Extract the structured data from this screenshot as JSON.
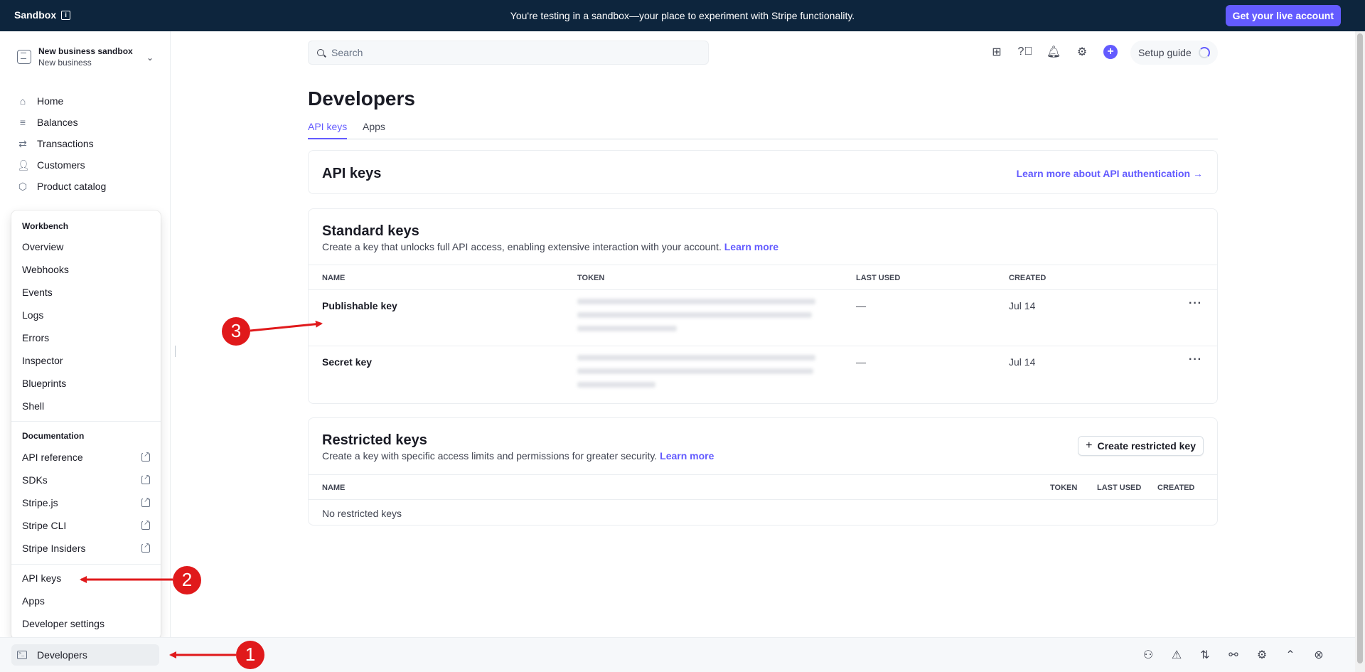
{
  "banner": {
    "sandbox_label": "Sandbox",
    "message": "You're testing in a sandbox—your place to experiment with Stripe functionality.",
    "live_button": "Get your live account"
  },
  "account": {
    "name": "New business sandbox",
    "sub": "New business"
  },
  "nav": [
    {
      "label": "Home",
      "icon": "home-icon"
    },
    {
      "label": "Balances",
      "icon": "balances-icon"
    },
    {
      "label": "Transactions",
      "icon": "transactions-icon"
    },
    {
      "label": "Customers",
      "icon": "customers-icon"
    },
    {
      "label": "Product catalog",
      "icon": "product-catalog-icon"
    }
  ],
  "popup": {
    "workbench_heading": "Workbench",
    "workbench_items": [
      "Overview",
      "Webhooks",
      "Events",
      "Logs",
      "Errors",
      "Inspector",
      "Blueprints",
      "Shell"
    ],
    "documentation_heading": "Documentation",
    "doc_items": [
      "API reference",
      "SDKs",
      "Stripe.js",
      "Stripe CLI",
      "Stripe Insiders"
    ],
    "dev_items": [
      "API keys",
      "Apps",
      "Developer settings"
    ]
  },
  "bottom": {
    "developers_label": "Developers"
  },
  "search": {
    "placeholder": "Search"
  },
  "header": {
    "setup_guide": "Setup guide"
  },
  "page": {
    "title": "Developers",
    "tabs": [
      "API keys",
      "Apps"
    ]
  },
  "api_keys_card": {
    "title": "API keys",
    "link": "Learn more about API authentication →"
  },
  "standard_keys": {
    "title": "Standard keys",
    "description": "Create a key that unlocks full API access, enabling extensive interaction with your account.",
    "learn_more": "Learn more",
    "columns": [
      "NAME",
      "TOKEN",
      "LAST USED",
      "CREATED"
    ],
    "rows": [
      {
        "name": "Publishable key",
        "last_used": "—",
        "created": "Jul 14"
      },
      {
        "name": "Secret key",
        "last_used": "—",
        "created": "Jul 14"
      }
    ]
  },
  "restricted_keys": {
    "title": "Restricted keys",
    "description": "Create a key with specific access limits and permissions for greater security.",
    "learn_more": "Learn more",
    "create_button": "Create restricted key",
    "columns": [
      "NAME",
      "TOKEN",
      "LAST USED",
      "CREATED"
    ],
    "empty": "No restricted keys"
  },
  "annotations": [
    "1",
    "2",
    "3"
  ],
  "colors": {
    "accent": "#635bff",
    "banner": "#0d253d",
    "annotation": "#e0191b"
  }
}
